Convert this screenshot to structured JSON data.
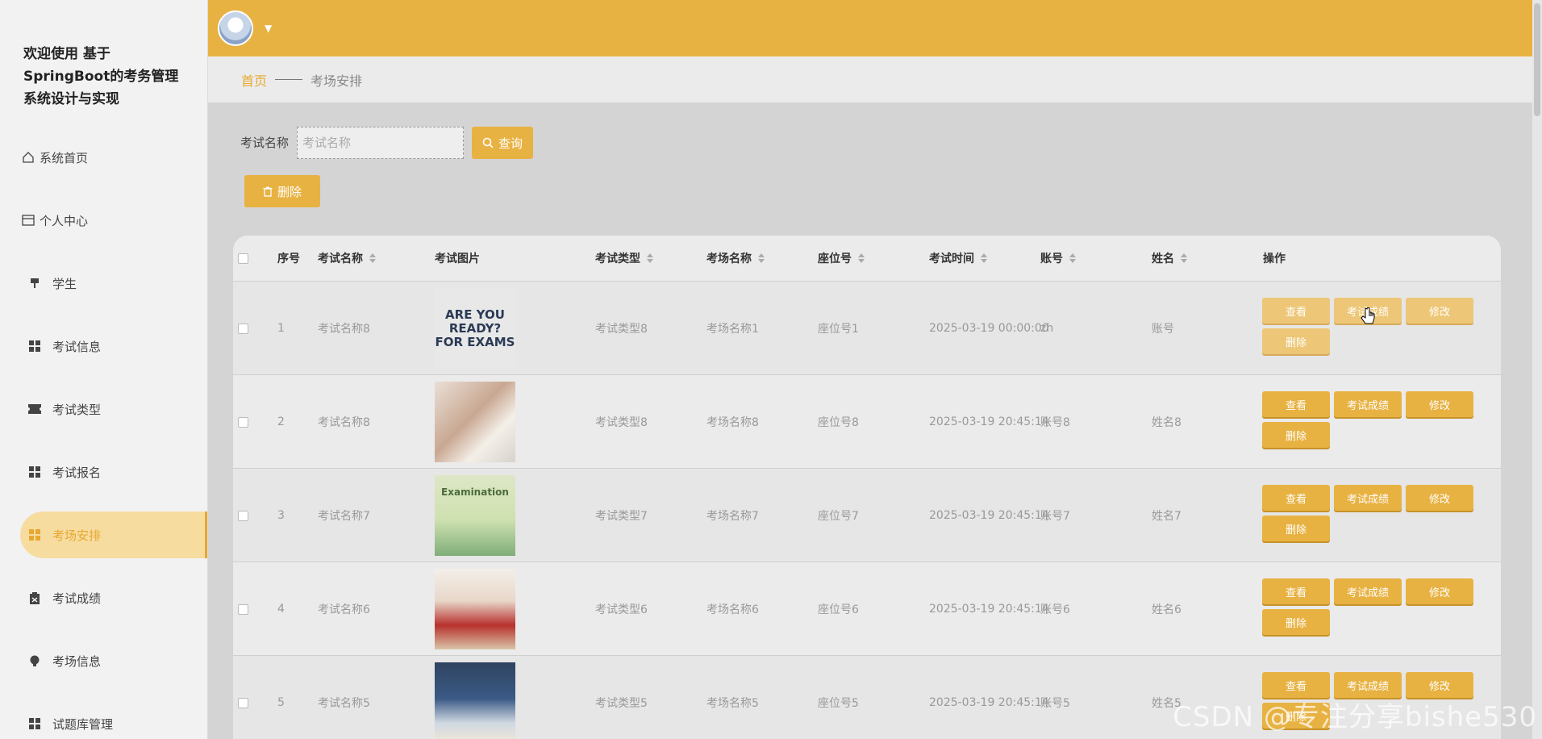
{
  "sidebar": {
    "title": "欢迎使用 基于\nSpringBoot的考务管理\n系统设计与实现",
    "items": [
      {
        "label": "系统首页",
        "icon": "home-icon"
      },
      {
        "label": "个人中心",
        "icon": "id-card-icon"
      },
      {
        "label": "学生",
        "icon": "pin-icon"
      },
      {
        "label": "考试信息",
        "icon": "grid-icon"
      },
      {
        "label": "考试类型",
        "icon": "ticket-icon"
      },
      {
        "label": "考试报名",
        "icon": "grid-icon"
      },
      {
        "label": "考场安排",
        "icon": "grid-icon",
        "active": true
      },
      {
        "label": "考试成绩",
        "icon": "clipboard-icon"
      },
      {
        "label": "考场信息",
        "icon": "bulb-icon"
      },
      {
        "label": "试题库管理",
        "icon": "grid-icon"
      }
    ]
  },
  "breadcrumb": {
    "home": "首页",
    "current": "考场安排"
  },
  "search": {
    "label": "考试名称",
    "placeholder": "考试名称",
    "button": "查询"
  },
  "toolbar": {
    "delete_label": "删除"
  },
  "table": {
    "headers": [
      "序号",
      "考试名称",
      "考试图片",
      "考试类型",
      "考场名称",
      "座位号",
      "考试时间",
      "账号",
      "姓名",
      "操作"
    ],
    "rows": [
      {
        "no": "1",
        "exam_name": "考试名称8",
        "image_text": "ARE YOU READY? FOR EXAMS",
        "exam_type": "考试类型8",
        "room": "考场名称1",
        "seat": "座位号1",
        "time": "2025-03-19 00:00:00",
        "account": "zh",
        "name": "账号"
      },
      {
        "no": "2",
        "exam_name": "考试名称8",
        "image_text": "",
        "exam_type": "考试类型8",
        "room": "考场名称8",
        "seat": "座位号8",
        "time": "2025-03-19 20:45:14",
        "account": "账号8",
        "name": "姓名8"
      },
      {
        "no": "3",
        "exam_name": "考试名称7",
        "image_text": "Examination",
        "exam_type": "考试类型7",
        "room": "考场名称7",
        "seat": "座位号7",
        "time": "2025-03-19 20:45:14",
        "account": "账号7",
        "name": "姓名7"
      },
      {
        "no": "4",
        "exam_name": "考试名称6",
        "image_text": "",
        "exam_type": "考试类型6",
        "room": "考场名称6",
        "seat": "座位号6",
        "time": "2025-03-19 20:45:14",
        "account": "账号6",
        "name": "姓名6"
      },
      {
        "no": "5",
        "exam_name": "考试名称5",
        "image_text": "",
        "exam_type": "考试类型5",
        "room": "考场名称5",
        "seat": "座位号5",
        "time": "2025-03-19 20:45:14",
        "account": "账号5",
        "name": "姓名5"
      }
    ],
    "actions": [
      "查看",
      "考试成绩",
      "修改",
      "删除"
    ]
  },
  "watermark": "CSDN @专注分享bishe530",
  "colors": {
    "accent": "#e8b242",
    "active_text": "#e6a830"
  }
}
